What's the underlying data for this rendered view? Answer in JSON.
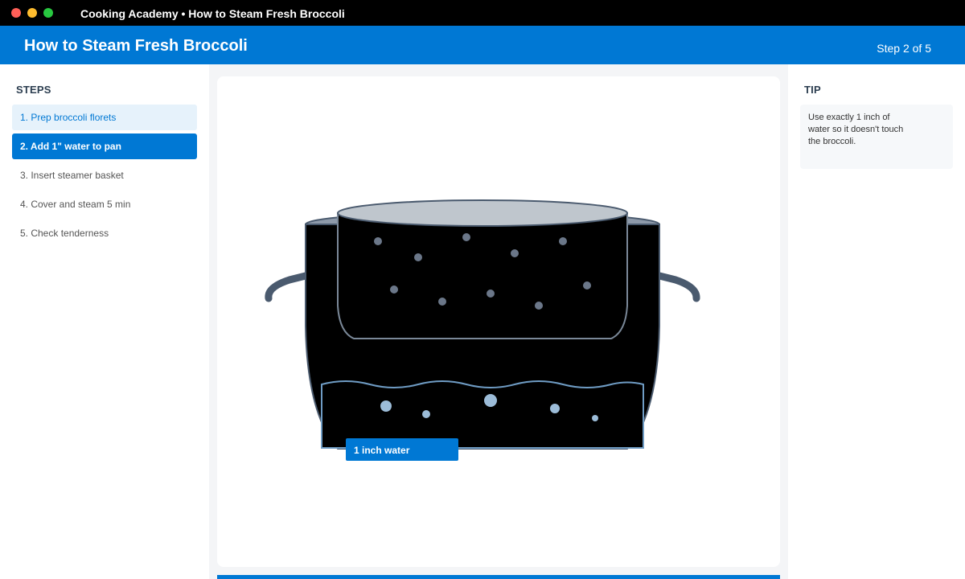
{
  "window": {
    "title": "Cooking Academy • How to Steam Fresh Broccoli"
  },
  "header": {
    "title": "How to Steam Fresh Broccoli",
    "step_indicator": "Step 2 of 5"
  },
  "sidebar": {
    "heading": "STEPS",
    "items": [
      {
        "label": "1. Prep broccoli florets",
        "state": "done"
      },
      {
        "label": "2. Add 1\" water to pan",
        "state": "active"
      },
      {
        "label": "3. Insert steamer basket",
        "state": "pending"
      },
      {
        "label": "4. Cover and steam 5 min",
        "state": "pending"
      },
      {
        "label": "5. Check tenderness",
        "state": "pending"
      }
    ]
  },
  "diagram": {
    "water_label": "1 inch water"
  },
  "tip": {
    "heading": "TIP",
    "text": "Use exactly 1 inch of water so it doesn't touch the broccoli."
  },
  "progress": {
    "fraction": 1.0
  },
  "colors": {
    "accent": "#0078d4",
    "titlebar": "#000000",
    "pot_outline": "#4a5a6e",
    "water_outline": "#6f9cc4",
    "bubble": "#9cbcd8",
    "steam_dot": "#6b7789"
  },
  "icons": {
    "window_controls": [
      "close-dot",
      "minimize-dot",
      "maximize-dot"
    ]
  }
}
